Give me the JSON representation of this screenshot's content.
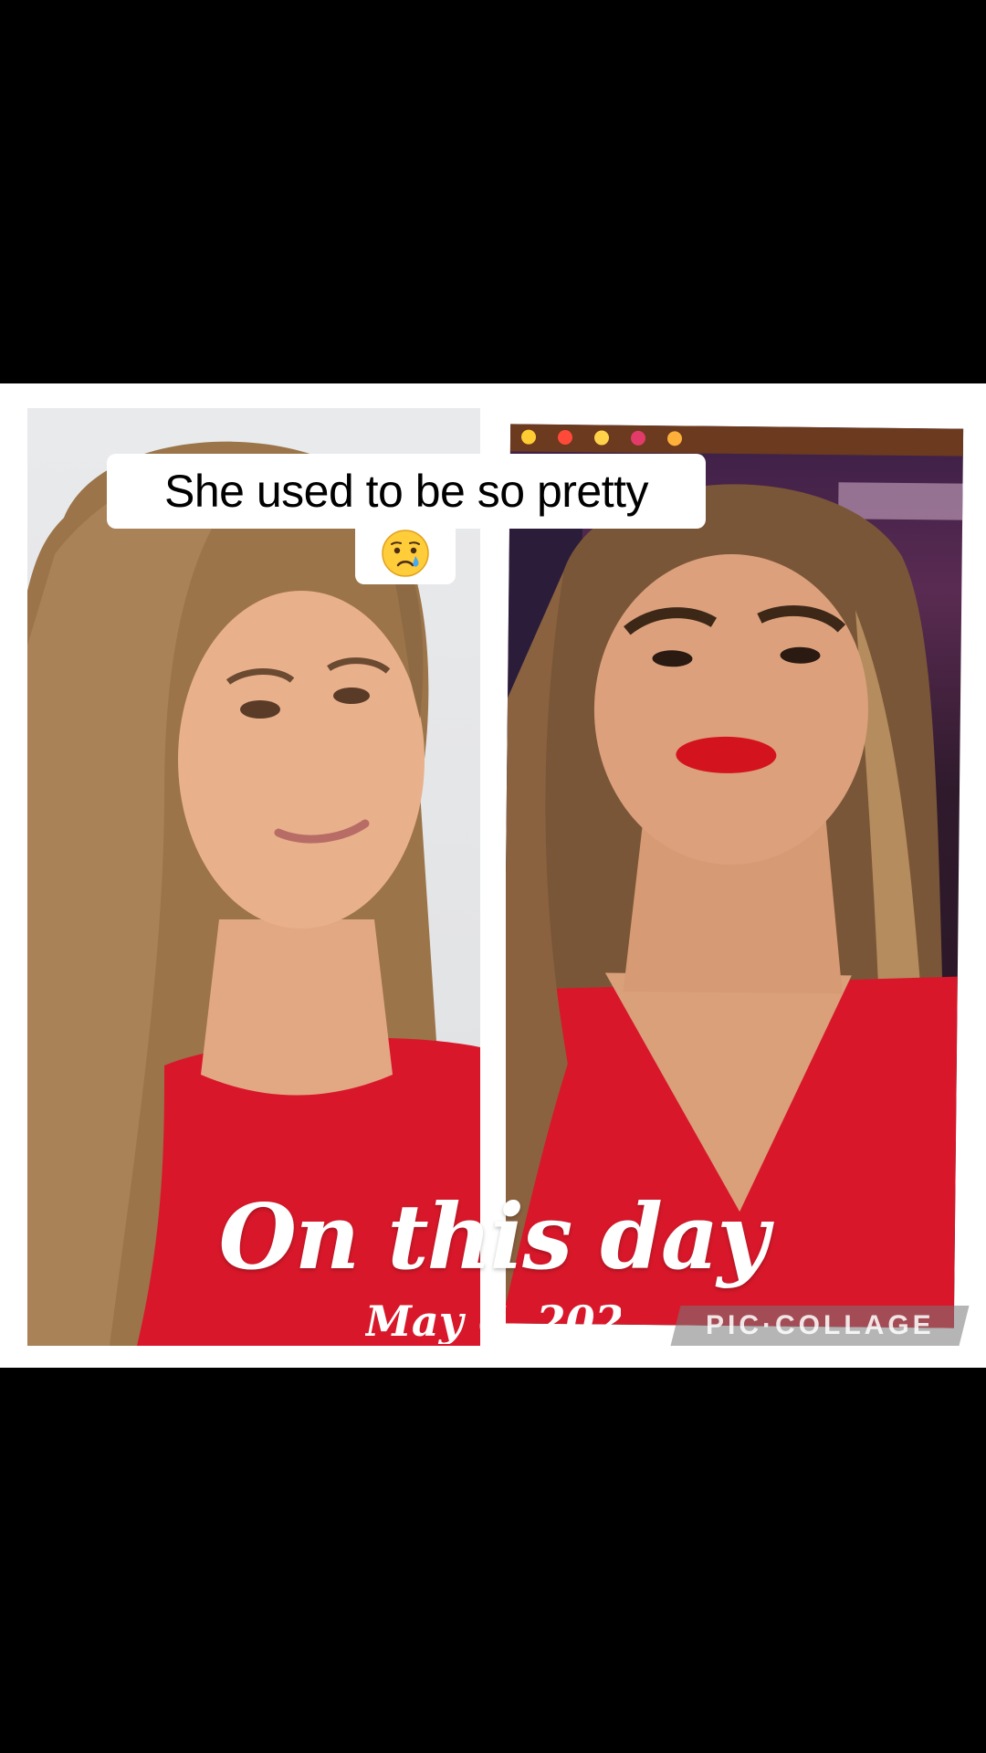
{
  "caption": {
    "line1": "She used to be so pretty",
    "emoji": "crying-face"
  },
  "overlay": {
    "headline": "On this day",
    "date": "May 6, 2025"
  },
  "watermark": {
    "text": "PIC·COLLAGE"
  },
  "colors": {
    "background": "#000000",
    "collage_bg": "#ffffff",
    "dress_red": "#d8182a",
    "lip_red": "#d3141f",
    "hair": "#a07a52"
  }
}
